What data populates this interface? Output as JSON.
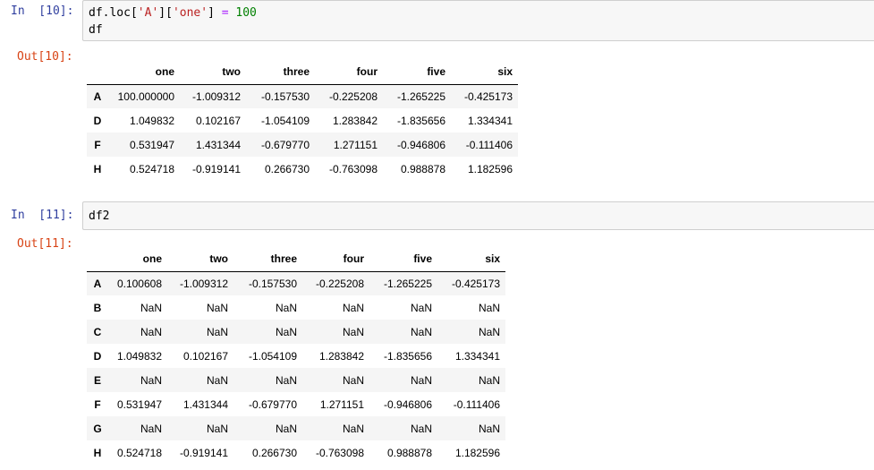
{
  "cells": [
    {
      "in_prompt": "In  [10]:",
      "code": {
        "line1": {
          "var": "df",
          "p1": ".loc[",
          "s1": "'A'",
          "p2": "][",
          "s2": "'one'",
          "p3": "] ",
          "op": "=",
          "sp": " ",
          "num": "100"
        },
        "line2": "df"
      },
      "out_prompt": "Out[10]:",
      "table": {
        "columns": [
          "one",
          "two",
          "three",
          "four",
          "five",
          "six"
        ],
        "rows": [
          {
            "index": "A",
            "values": [
              "100.000000",
              "-1.009312",
              "-0.157530",
              "-0.225208",
              "-1.265225",
              "-0.425173"
            ]
          },
          {
            "index": "D",
            "values": [
              "1.049832",
              "0.102167",
              "-1.054109",
              "1.283842",
              "-1.835656",
              "1.334341"
            ]
          },
          {
            "index": "F",
            "values": [
              "0.531947",
              "1.431344",
              "-0.679770",
              "1.271151",
              "-0.946806",
              "-0.111406"
            ]
          },
          {
            "index": "H",
            "values": [
              "0.524718",
              "-0.919141",
              "0.266730",
              "-0.763098",
              "0.988878",
              "1.182596"
            ]
          }
        ]
      }
    },
    {
      "in_prompt": "In  [11]:",
      "code": {
        "line1": "df2"
      },
      "out_prompt": "Out[11]:",
      "table": {
        "columns": [
          "one",
          "two",
          "three",
          "four",
          "five",
          "six"
        ],
        "rows": [
          {
            "index": "A",
            "values": [
              "0.100608",
              "-1.009312",
              "-0.157530",
              "-0.225208",
              "-1.265225",
              "-0.425173"
            ]
          },
          {
            "index": "B",
            "values": [
              "NaN",
              "NaN",
              "NaN",
              "NaN",
              "NaN",
              "NaN"
            ]
          },
          {
            "index": "C",
            "values": [
              "NaN",
              "NaN",
              "NaN",
              "NaN",
              "NaN",
              "NaN"
            ]
          },
          {
            "index": "D",
            "values": [
              "1.049832",
              "0.102167",
              "-1.054109",
              "1.283842",
              "-1.835656",
              "1.334341"
            ]
          },
          {
            "index": "E",
            "values": [
              "NaN",
              "NaN",
              "NaN",
              "NaN",
              "NaN",
              "NaN"
            ]
          },
          {
            "index": "F",
            "values": [
              "0.531947",
              "1.431344",
              "-0.679770",
              "1.271151",
              "-0.946806",
              "-0.111406"
            ]
          },
          {
            "index": "G",
            "values": [
              "NaN",
              "NaN",
              "NaN",
              "NaN",
              "NaN",
              "NaN"
            ]
          },
          {
            "index": "H",
            "values": [
              "0.524718",
              "-0.919141",
              "0.266730",
              "-0.763098",
              "0.988878",
              "1.182596"
            ]
          }
        ]
      }
    }
  ],
  "colors": {
    "in_prompt": "#303f9f",
    "out_prompt": "#d84315",
    "code_string": "#ba2121",
    "code_operator": "#aa22ff",
    "code_number": "#008000",
    "input_bg": "#f7f7f7",
    "table_stripe": "#f5f5f5"
  }
}
